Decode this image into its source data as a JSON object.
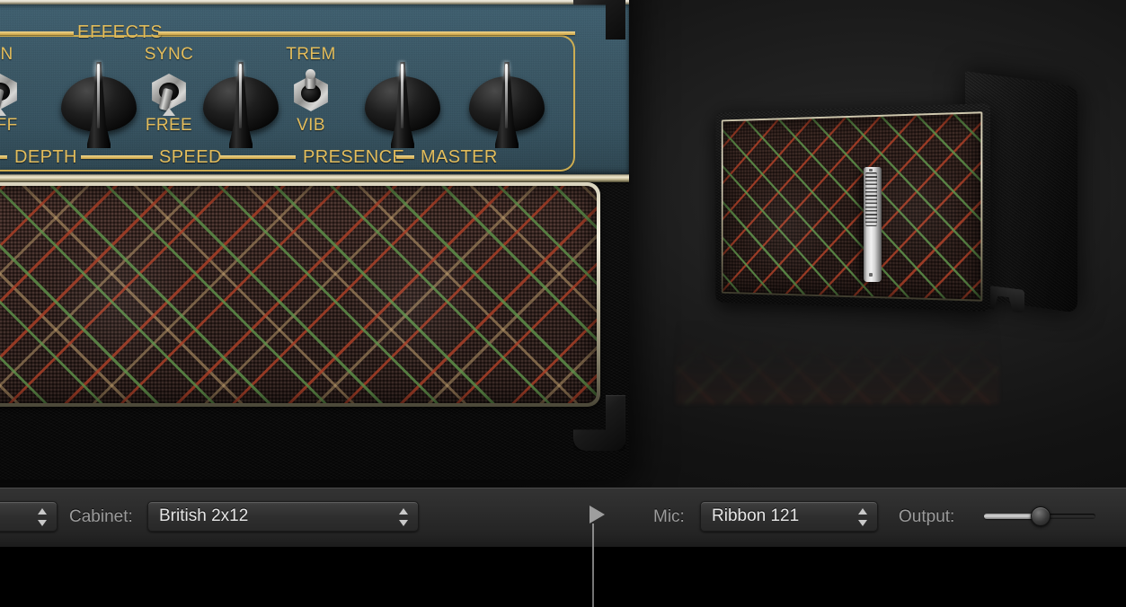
{
  "amp_panel": {
    "section_title": "EFFECTS",
    "switches": [
      {
        "name": "effects-on-off",
        "top_label": "ON",
        "bottom_label": "OFF",
        "position": "down"
      },
      {
        "name": "sync-free",
        "top_label": "SYNC",
        "bottom_label": "FREE",
        "position": "down"
      },
      {
        "name": "trem-vib",
        "top_label": "TREM",
        "bottom_label": "VIB",
        "position": "up"
      }
    ],
    "knobs": [
      {
        "name": "depth",
        "label": "DEPTH"
      },
      {
        "name": "speed",
        "label": "SPEED"
      },
      {
        "name": "presence",
        "label": "PRESENCE"
      },
      {
        "name": "master",
        "label": "MASTER"
      }
    ],
    "colors": {
      "panel": "#3a5866",
      "legend": "#e3bd5c",
      "trim": "#efe8cd"
    }
  },
  "cabinet_view": {
    "cabinet_name": "British 2x12",
    "mic_name": "Ribbon 121",
    "grille_colors": {
      "green": "#5c8e48",
      "red": "#a83e26",
      "tan": "#c1a06e",
      "cloth": "#2b1d19"
    }
  },
  "toolbar": {
    "amp_popup": {
      "value": "",
      "stepper": "stepper-icon"
    },
    "cabinet_label": "Cabinet:",
    "cabinet_value": "British 2x12",
    "mic_label": "Mic:",
    "mic_value": "Ribbon 121",
    "output_label": "Output:",
    "output_value": "50",
    "playhead": "playhead-marker"
  }
}
